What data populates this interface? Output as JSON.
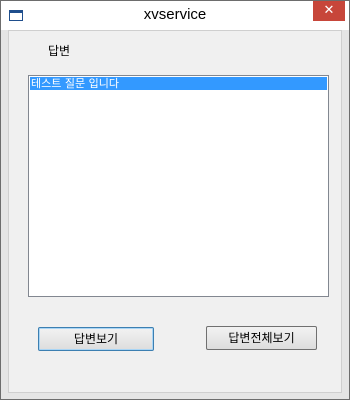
{
  "window": {
    "title": "xvservice",
    "close_glyph": "✕"
  },
  "answer": {
    "label": "답변",
    "items": [
      "테스트 질문 입니다"
    ]
  },
  "buttons": {
    "view_answer": "답변보기",
    "view_all_answers": "답변전체보기"
  },
  "colors": {
    "selection": "#3399ff",
    "close_button": "#c7463a"
  }
}
